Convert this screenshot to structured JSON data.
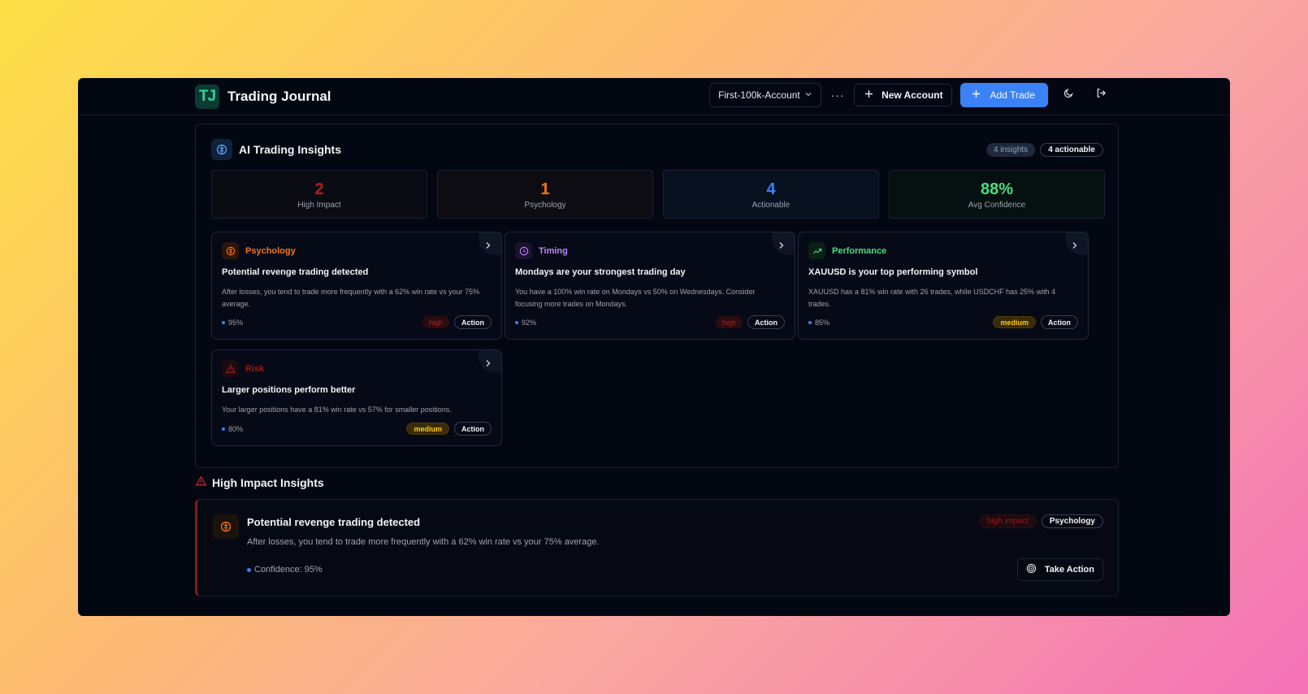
{
  "header": {
    "logo_text": "TJ",
    "title": "Trading Journal",
    "account_select": "First-100k-Account",
    "more_label": "···",
    "new_account_label": "New Account",
    "add_trade_label": "Add Trade"
  },
  "insights_panel": {
    "title": "AI Trading Insights",
    "count_badge": "4 insights",
    "actionable_badge": "4 actionable",
    "stats": [
      {
        "value": "2",
        "label": "High Impact",
        "color": "#b91c1c"
      },
      {
        "value": "1",
        "label": "Psychology",
        "color": "#f97316"
      },
      {
        "value": "4",
        "label": "Actionable",
        "color": "#3b82f6"
      },
      {
        "value": "88%",
        "label": "Avg Confidence",
        "color": "#4ade80"
      }
    ],
    "cards": [
      {
        "category": "Psychology",
        "cat_color": "#f97316",
        "icon": "brain-icon",
        "title": "Potential revenge trading detected",
        "desc": "After losses, you tend to trade more frequently with a 62% win rate vs your 75% average.",
        "confidence": "95%",
        "severity": "high",
        "action": "Action"
      },
      {
        "category": "Timing",
        "cat_color": "#c084fc",
        "icon": "clock-icon",
        "title": "Mondays are your strongest trading day",
        "desc": "You have a 100% win rate on Mondays vs 50% on Wednesdays. Consider focusing more trades on Mondays.",
        "confidence": "92%",
        "severity": "high",
        "action": "Action"
      },
      {
        "category": "Performance",
        "cat_color": "#4ade80",
        "icon": "trending-up-icon",
        "title": "XAUUSD is your top performing symbol",
        "desc": "XAUUSD has a 81% win rate with 26 trades, while USDCHF has 25% with 4 trades.",
        "confidence": "85%",
        "severity": "medium",
        "action": "Action"
      },
      {
        "category": "Risk",
        "cat_color": "#991b1b",
        "icon": "warning-icon",
        "title": "Larger positions perform better",
        "desc": "Your larger positions have a 81% win rate vs 57% for smaller positions.",
        "confidence": "80%",
        "severity": "medium",
        "action": "Action"
      }
    ]
  },
  "high_impact": {
    "title": "High Impact Insights",
    "item": {
      "title": "Potential revenge trading detected",
      "desc": "After losses, you tend to trade more frequently with a 62% win rate vs your 75% average.",
      "confidence": "Confidence: 95%",
      "impact_badge": "high impact",
      "category_badge": "Psychology",
      "action_label": "Take Action"
    }
  }
}
